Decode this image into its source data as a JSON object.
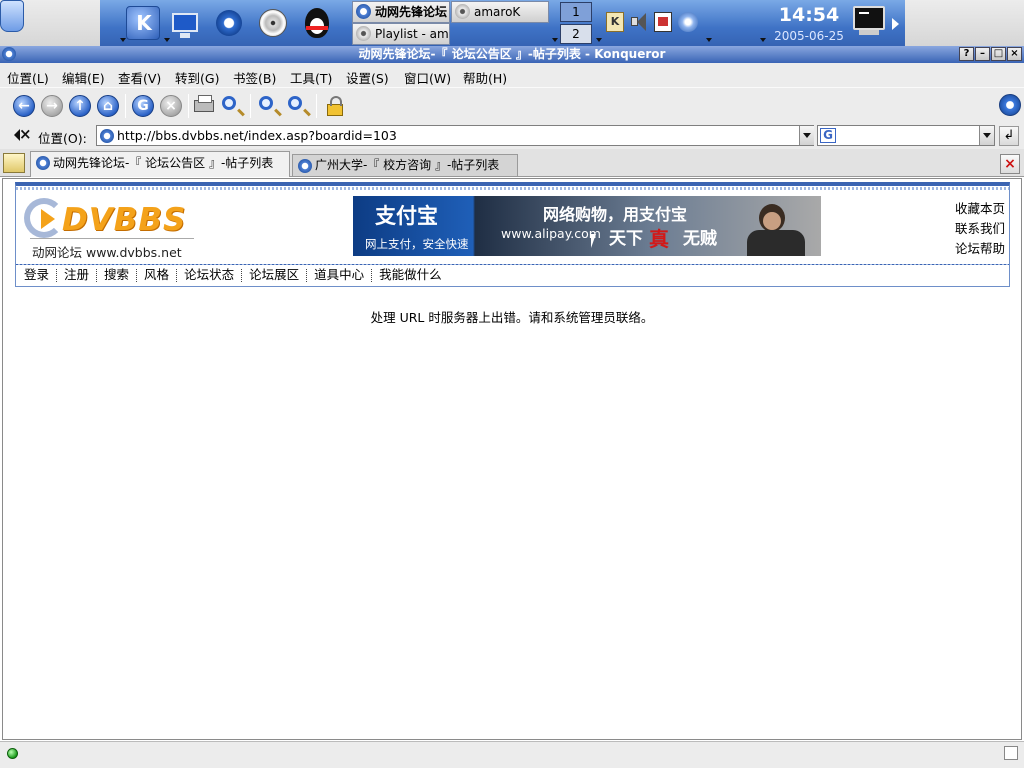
{
  "panel": {
    "tasks": [
      {
        "label": "动网先锋论坛"
      },
      {
        "label": "amaroK"
      },
      {
        "label": "Playlist - am"
      }
    ],
    "pager": [
      "1",
      "2"
    ],
    "tray_k": "K",
    "clock_time": "14:54",
    "clock_date": "2005-06-25"
  },
  "window": {
    "title": "动网先锋论坛-『 论坛公告区 』-帖子列表 - Konqueror",
    "buttons": {
      "help": "?",
      "minimize": "–",
      "maximize": "□",
      "close": "×"
    }
  },
  "menubar": [
    "位置(L)",
    "编辑(E)",
    "查看(V)",
    "转到(G)",
    "书签(B)",
    "工具(T)",
    "设置(S)",
    "窗口(W)",
    "帮助(H)"
  ],
  "toolbar": {
    "reload": "G"
  },
  "location": {
    "label": "位置(O):",
    "url": "http://bbs.dvbbs.net/index.asp?boardid=103",
    "search_logo": "G",
    "go": "↲"
  },
  "tabs": [
    {
      "label": "动网先锋论坛-『 论坛公告区 』-帖子列表",
      "active": true
    },
    {
      "label": "广州大学-『 校方咨询 』-帖子列表",
      "active": false
    }
  ],
  "tab_close": "×",
  "page": {
    "logo_word": "DVBBS",
    "logo_sub": "动网论坛 www.dvbbs.net",
    "banner": {
      "brand": "支付宝",
      "tagline": "网上支付，安全快速",
      "headline": "网络购物，用支付宝",
      "url": "www.alipay.com",
      "slogan_a": "天下",
      "slogan_b": "真",
      "slogan_c": "无贼"
    },
    "header_links": [
      "收藏本页",
      "联系我们",
      "论坛帮助"
    ],
    "nav": [
      "登录",
      "注册",
      "搜索",
      "风格",
      "论坛状态",
      "论坛展区",
      "道具中心",
      "我能做什么"
    ],
    "error": "处理 URL 时服务器上出错。请和系统管理员联络。"
  },
  "status": {
    "text": ""
  },
  "colors": {
    "panel_blue": "#3f73c6",
    "title_blue": "#3a64b5",
    "forum_border": "#6e8fc9",
    "logo_orange": "#f4a21a"
  }
}
